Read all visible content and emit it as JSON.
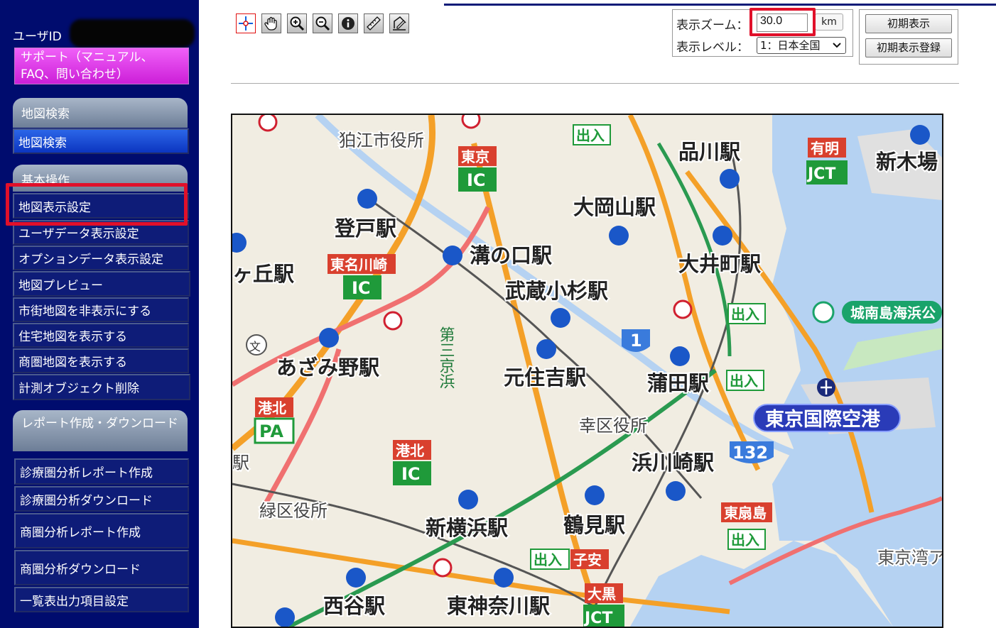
{
  "sidebar": {
    "user_id_label": "ユーザID",
    "support_button": "サポート（マニュアル、FAQ、問い合わせ）",
    "sections": {
      "map_search_header": "地図検索",
      "basic_ops_header": "基本操作",
      "report_header": "レポート作成・ダウンロード"
    },
    "map_search_item": "地図検索",
    "basic_ops_items": [
      "地図表示設定",
      "ユーザデータ表示設定",
      "オプションデータ表示設定",
      "地図プレビュー",
      "市街地図を非表示にする",
      "住宅地図を表示する",
      "商圏地図を表示する",
      "計測オブジェクト削除"
    ],
    "report_items": [
      "診療圏分析レポート作成",
      "診療圏分析ダウンロード",
      "商圏分析レポート作成",
      "商圏分析ダウンロード",
      "一覧表出力項目設定"
    ]
  },
  "toolbar": {
    "icons": [
      "crosshair-icon",
      "pan-hand-icon",
      "zoom-in-icon",
      "zoom-out-icon",
      "info-icon",
      "ruler-icon",
      "draw-icon"
    ]
  },
  "zoom_panel": {
    "zoom_label": "表示ズーム：",
    "zoom_value": "30.0",
    "zoom_unit": "km",
    "level_label": "表示レベル：",
    "level_value": "1：日本全国"
  },
  "init_buttons": {
    "initial_display": "初期表示",
    "initial_display_register": "初期表示登録"
  },
  "map": {
    "stations": [
      "品川駅",
      "新木場",
      "大岡山駅",
      "登戸駅",
      "溝の口駅",
      "大井町駅",
      "ヶ丘駅",
      "武蔵小杉駅",
      "あざみ野駅",
      "元住吉駅",
      "蒲田駅",
      "浜川崎駅",
      "新横浜駅",
      "鶴見駅",
      "西谷駅",
      "東神奈川駅"
    ],
    "offices": [
      "狛江市役所",
      "幸区役所",
      "緑区役所"
    ],
    "airport": "東京国際空港",
    "park": "城南島海浜公",
    "bay": "東京湾ア",
    "road_labels": {
      "tokyo": "東京",
      "ic": "IC",
      "toumei_kawasaki": "東名川崎",
      "kohoku": "港北",
      "pa": "PA",
      "ariake": "有明",
      "jct": "JCT",
      "higashi_ogishima": "東扇島",
      "daikoku": "大黒",
      "koyasu": "子安",
      "exit": "出入",
      "daisan_keihin": "第三京浜",
      "route_1": "1",
      "route_132": "132",
      "left_edge": "駅",
      "bun": "文"
    }
  },
  "colors": {
    "sidebar_bg": "#000c6e",
    "support_button": "#e23ee8",
    "highlight_red": "#e0102a",
    "map_search_blue": "#1a4ad8"
  }
}
